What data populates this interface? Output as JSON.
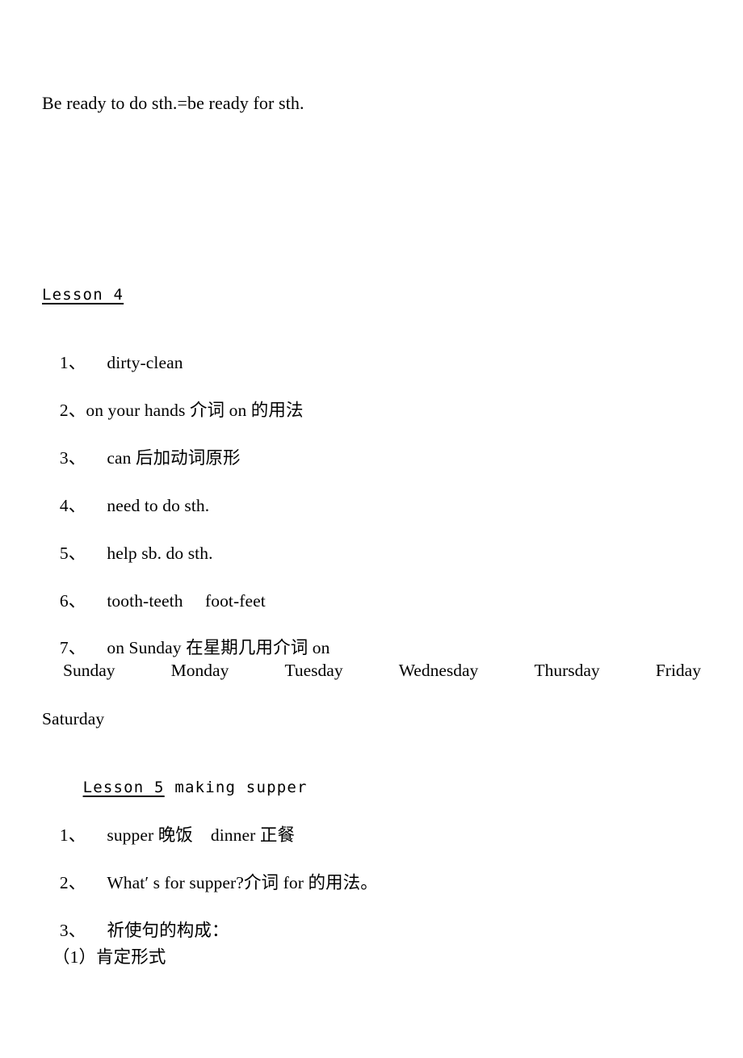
{
  "document": {
    "intro_line": "Be ready to do sth.=be ready for sth."
  },
  "lesson4": {
    "heading_label": "Lesson 4",
    "items": [
      {
        "num": "1、",
        "text": "dirty-clean"
      },
      {
        "num": "2、",
        "text": "on your hands 介词 on 的用法"
      },
      {
        "num": "3、",
        "text": "can 后加动词原形"
      },
      {
        "num": "4、",
        "text": "need to do sth."
      },
      {
        "num": "5、",
        "text": "help sb. do sth."
      },
      {
        "num": "6、",
        "text": "tooth-teeth     foot-feet"
      },
      {
        "num": "7、",
        "text": "on Sunday 在星期几用介词 on"
      }
    ],
    "weekdays": [
      "Sunday",
      "Monday",
      "Tuesday",
      "Wednesday",
      "Thursday",
      "Friday"
    ],
    "weekday_last": "Saturday"
  },
  "lesson5": {
    "heading_label": "Lesson 5",
    "heading_tail": " making supper",
    "items": [
      {
        "num": "1、",
        "text": "supper 晚饭    dinner 正餐"
      },
      {
        "num": "2、",
        "text": "What′ s for supper?介词 for 的用法。"
      },
      {
        "num": "3、",
        "text": "祈使句的构成："
      }
    ],
    "sub_item": "（1）肯定形式"
  }
}
